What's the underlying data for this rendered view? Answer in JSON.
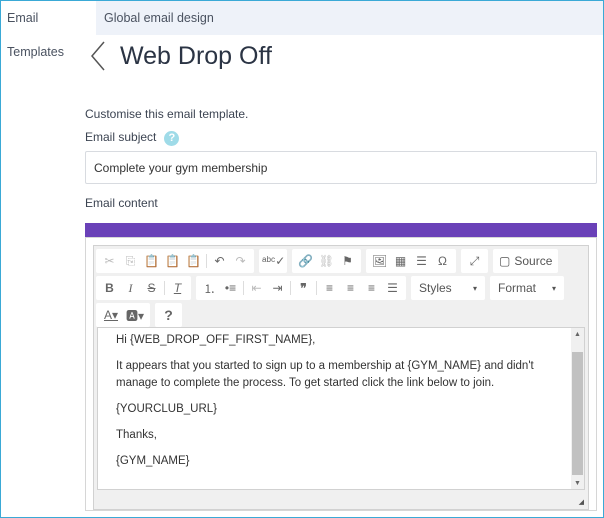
{
  "tabs": [
    {
      "label": "Email Templates",
      "active": true
    },
    {
      "label": "Global email design",
      "active": false
    }
  ],
  "page": {
    "title": "Web Drop Off",
    "description": "Customise this email template.",
    "subject_label": "Email subject",
    "help_glyph": "?",
    "subject_value": "Complete your gym membership",
    "content_label": "Email content"
  },
  "colors": {
    "accent_bar": "#6a41b8",
    "frame": "#3aa9d6"
  },
  "toolbar": {
    "source_label": "Source",
    "styles_label": "Styles",
    "format_label": "Format",
    "help": "?"
  },
  "body": [
    "Hi {WEB_DROP_OFF_FIRST_NAME},",
    "It appears that you started to sign up to a membership at {GYM_NAME} and didn't manage to complete the process. To get started click the link below to join.",
    "{YOURCLUB_URL}",
    "Thanks,",
    "{GYM_NAME}"
  ]
}
